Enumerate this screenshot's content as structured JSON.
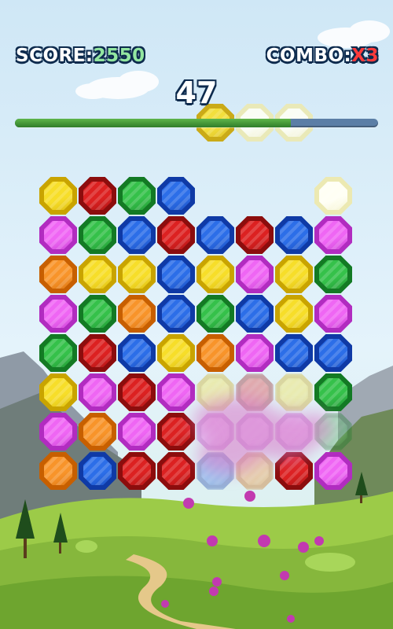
{
  "hud": {
    "score_label": "SCORE:",
    "score_value": "2550",
    "combo_label": "COMBO:",
    "combo_value": "X3",
    "timer": "47"
  },
  "progress": {
    "fraction": 0.76
  },
  "colors": {
    "yellow": [
      "#c9a400",
      "#f7de29"
    ],
    "red": [
      "#8c0d0d",
      "#dc2121"
    ],
    "green": [
      "#137a24",
      "#35c14a"
    ],
    "blue": [
      "#0f3aa6",
      "#2c6ee8"
    ],
    "pink": [
      "#b12cc0",
      "#ef66f4"
    ],
    "orange": [
      "#c75f00",
      "#f8942a"
    ],
    "white": [
      "#ece9b2",
      "#fffff4"
    ]
  },
  "board": {
    "columns": 8,
    "rows": [
      [
        "yellow",
        "red",
        "green",
        "blue",
        null,
        null,
        null,
        "white"
      ],
      [
        "pink",
        "green",
        "blue",
        "red",
        "blue",
        "red",
        "blue",
        "pink"
      ],
      [
        "orange",
        "yellow",
        "yellow",
        "blue",
        "yellow",
        "pink",
        "yellow",
        "green"
      ],
      [
        "pink",
        "green",
        "orange",
        "blue",
        "green",
        "blue",
        "yellow",
        "pink"
      ],
      [
        "green",
        "red",
        "blue",
        "yellow",
        "orange",
        "pink",
        "blue",
        "blue"
      ],
      [
        "yellow",
        "pink",
        "red",
        "pink",
        "yellow",
        "red",
        "yellow",
        "green"
      ],
      [
        "pink",
        "orange",
        "pink",
        "red",
        "pink",
        "pink",
        "pink",
        "green"
      ],
      [
        "orange",
        "blue",
        "red",
        "red",
        "blue",
        "orange",
        "red",
        "pink"
      ]
    ],
    "faded_cells": [
      [
        5,
        4
      ],
      [
        5,
        5
      ],
      [
        5,
        6
      ],
      [
        6,
        4
      ],
      [
        6,
        5
      ],
      [
        6,
        6
      ],
      [
        6,
        7
      ],
      [
        7,
        4
      ],
      [
        7,
        5
      ]
    ],
    "falling": [
      {
        "color": "yellow",
        "column": 4
      },
      {
        "color": "white",
        "column": 5
      },
      {
        "color": "white",
        "column": 6
      }
    ]
  }
}
